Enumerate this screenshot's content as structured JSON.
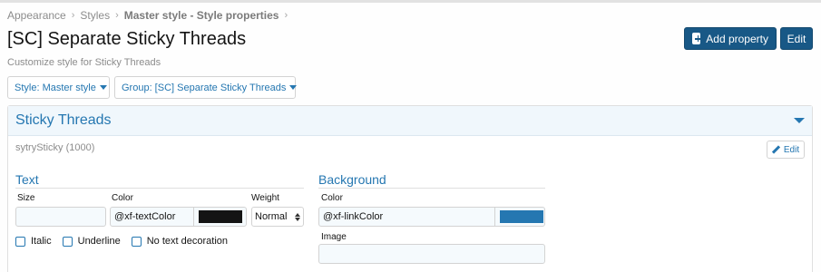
{
  "breadcrumb": [
    "Appearance",
    "Styles",
    "Master style - Style properties"
  ],
  "page": {
    "title": "[SC] Separate Sticky Threads",
    "description": "Customize style for Sticky Threads"
  },
  "header_buttons": {
    "add_property": "Add property",
    "edit": "Edit"
  },
  "filters": {
    "style": "Style: Master style",
    "group": "Group: [SC] Separate Sticky Threads"
  },
  "panel": {
    "title": "Sticky Threads",
    "property_id": "sytrySticky (1000)",
    "edit_label": "Edit",
    "text_section": {
      "title": "Text",
      "size_label": "Size",
      "size_value": "",
      "color_label": "Color",
      "color_value": "@xf-textColor",
      "color_swatch": "#141414",
      "weight_label": "Weight",
      "weight_value": "Normal",
      "checkboxes": [
        "Italic",
        "Underline",
        "No text decoration"
      ]
    },
    "background_section": {
      "title": "Background",
      "color_label": "Color",
      "color_value": "@xf-linkColor",
      "color_swatch": "#2577b1",
      "image_label": "Image",
      "image_value": ""
    }
  },
  "colors": {
    "accent": "#2577b1",
    "primary_button": "#185886",
    "header_bg": "#f0f7fc"
  },
  "icons": {
    "add": "plus-square-icon",
    "edit": "pencil-icon",
    "toggle": "caret-down-icon"
  }
}
